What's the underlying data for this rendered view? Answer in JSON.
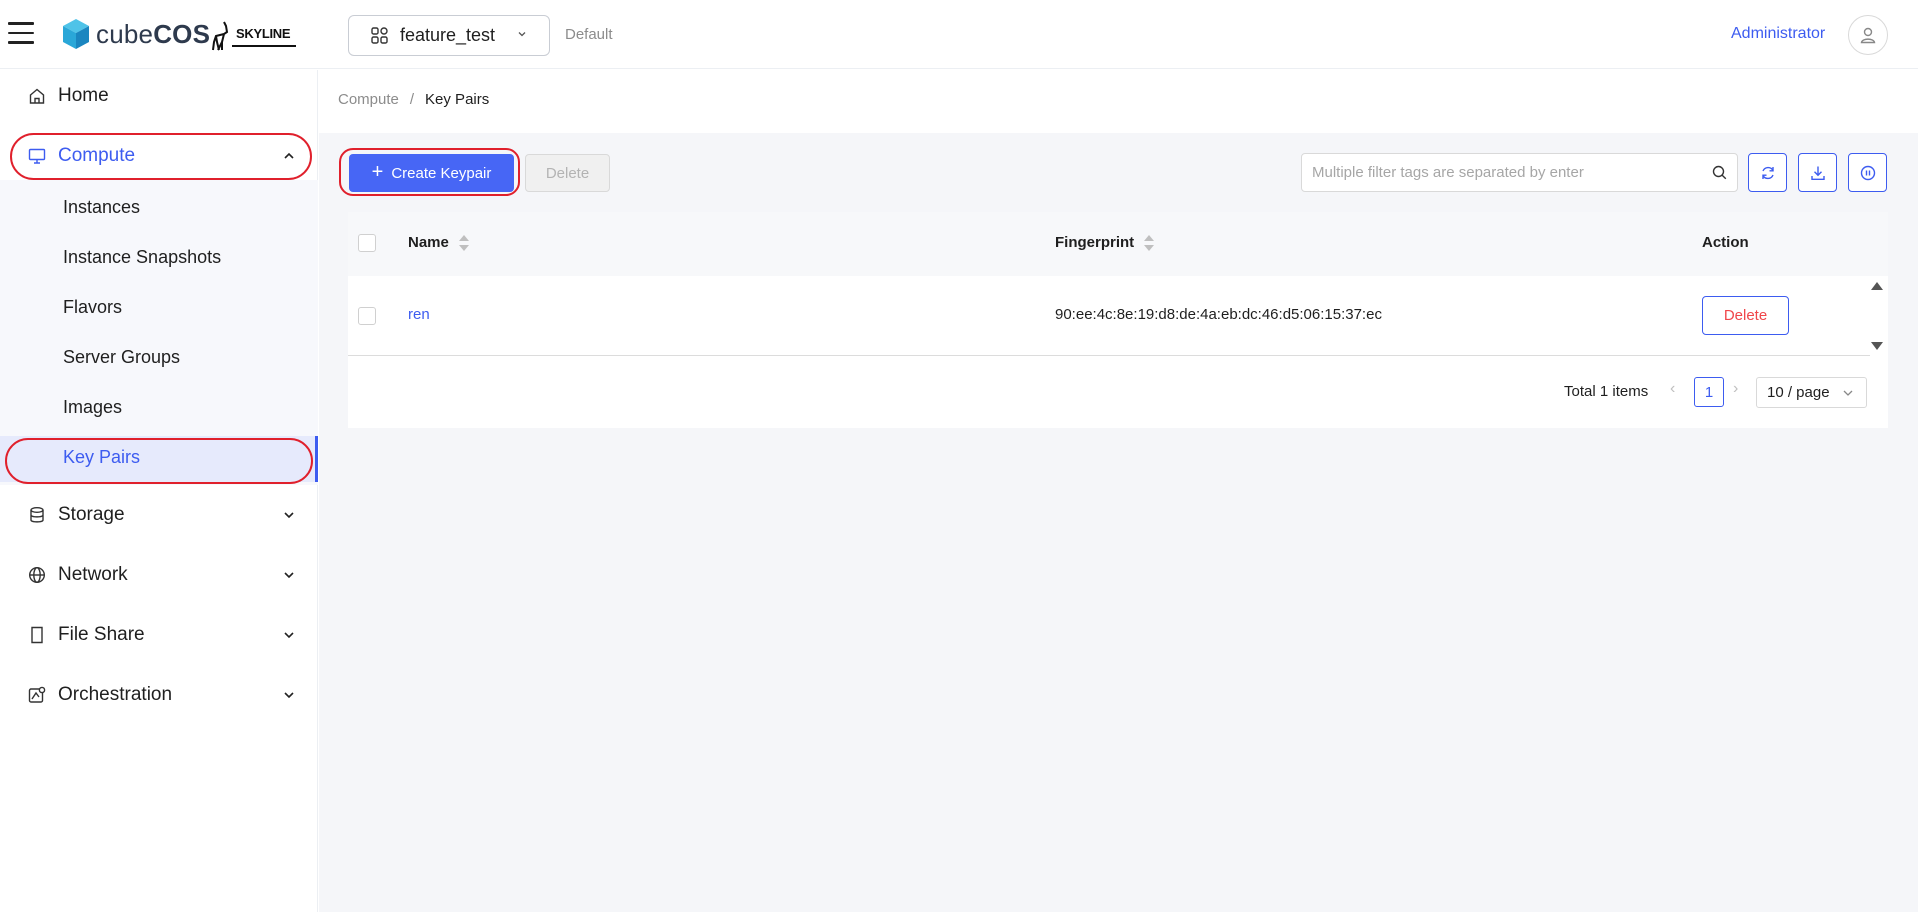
{
  "header": {
    "brand_prefix": "cube",
    "brand_suffix": "COS",
    "partner": "SKYLINE",
    "project": "feature_test",
    "domain": "Default",
    "user": "Administrator"
  },
  "sidebar": {
    "items": [
      {
        "label": "Home",
        "icon": "home-icon"
      },
      {
        "label": "Compute",
        "icon": "monitor-icon",
        "expanded": true
      },
      {
        "label": "Storage",
        "icon": "database-icon"
      },
      {
        "label": "Network",
        "icon": "globe-icon"
      },
      {
        "label": "File Share",
        "icon": "file-icon"
      },
      {
        "label": "Orchestration",
        "icon": "orchestration-icon"
      }
    ],
    "compute_children": [
      "Instances",
      "Instance Snapshots",
      "Flavors",
      "Server Groups",
      "Images",
      "Key Pairs"
    ],
    "active_child": "Key Pairs"
  },
  "breadcrumb": [
    "Compute",
    "Key Pairs"
  ],
  "toolbar": {
    "create_label": "Create Keypair",
    "delete_label": "Delete",
    "search_placeholder": "Multiple filter tags are separated by enter"
  },
  "table": {
    "columns": [
      "Name",
      "Fingerprint",
      "Action"
    ],
    "rows": [
      {
        "name": "ren",
        "fingerprint": "90:ee:4c:8e:19:d8:de:4a:eb:dc:46:d5:06:15:37:ec",
        "action": "Delete"
      }
    ]
  },
  "pagination": {
    "total_text": "Total 1 items",
    "current_page": "1",
    "page_size": "10 / page"
  },
  "colors": {
    "accent": "#3d5cf0",
    "primary_button": "#4766f5",
    "danger_text": "#f0464a",
    "highlight_ring": "#e0202c"
  }
}
